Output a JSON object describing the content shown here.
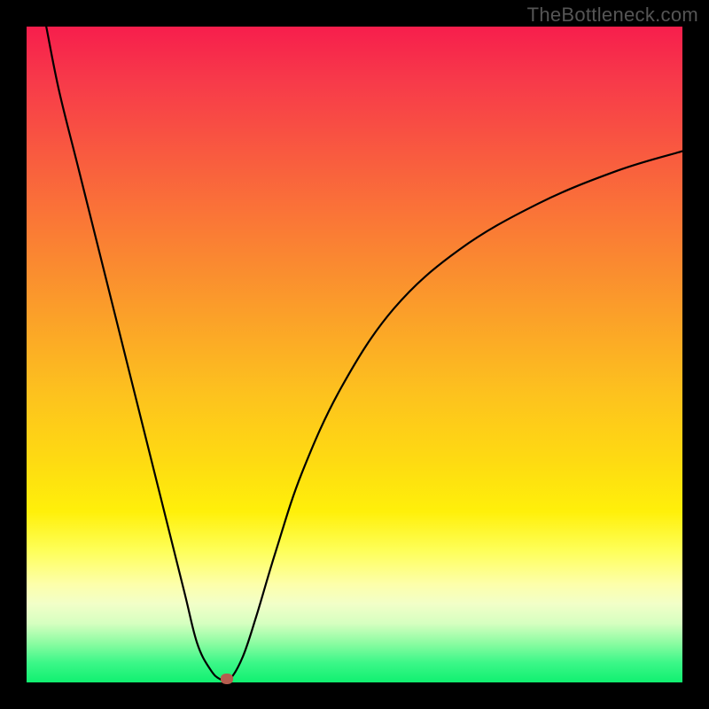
{
  "watermark": "TheBottleneck.com",
  "colors": {
    "frame": "#000000",
    "watermark": "#555555",
    "curve": "#000000",
    "marker": "#b65c4f"
  },
  "chart_data": {
    "type": "line",
    "title": "",
    "xlabel": "",
    "ylabel": "",
    "xlim": [
      0,
      100
    ],
    "ylim": [
      0,
      100
    ],
    "grid": false,
    "series": [
      {
        "name": "bottleneck-curve",
        "x": [
          3,
          5,
          8,
          12,
          16,
          20,
          24,
          26,
          28,
          29.5,
          31,
          33,
          35,
          38,
          42,
          48,
          56,
          66,
          78,
          90,
          100
        ],
        "y": [
          100,
          90,
          78,
          62,
          46,
          30,
          14,
          6,
          2,
          0.5,
          0.5,
          4,
          10,
          20,
          32,
          45,
          57,
          66,
          73,
          78,
          81
        ]
      }
    ],
    "marker": {
      "x": 30.5,
      "y": 0.6
    }
  }
}
